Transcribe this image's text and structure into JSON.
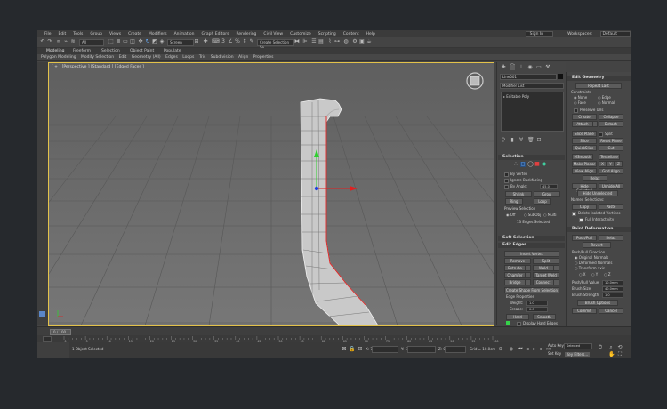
{
  "menu": [
    "File",
    "Edit",
    "Tools",
    "Group",
    "Views",
    "Create",
    "Modifiers",
    "Animation",
    "Graph Editors",
    "Rendering",
    "Civil View",
    "Customize",
    "Scripting",
    "Content",
    "Help"
  ],
  "sign_in": "Sign In",
  "workspaces_label": "Workspaces:",
  "workspaces_value": "Default",
  "toolbar": {
    "all_filter": "All",
    "ref_coord": "Screen",
    "selection_set": "Create Selection Se"
  },
  "ribbon_tabs": [
    "Modeling",
    "Freeform",
    "Selection",
    "Object Paint",
    "Populate"
  ],
  "ribbon_sub": [
    "Polygon Modeling",
    "Modify Selection",
    "Edit",
    "Geometry (All)",
    "Edges",
    "Loops",
    "Tris",
    "Subdivision",
    "Align",
    "Properties"
  ],
  "viewport_label": "[ + ] [Perspective ] [Standard ] [Edged Faces ]",
  "command_panel": {
    "object_name": "Line001",
    "modifier_list": "Modifier List",
    "stack_item": "Editable Poly",
    "selection": {
      "title": "Selection",
      "by_vertex": "By Vertex",
      "ignore_backfacing": "Ignore Backfacing",
      "by_angle": "By Angle:",
      "by_angle_value": "45.0",
      "shrink": "Shrink",
      "grow": "Grow",
      "ring": "Ring",
      "loop": "Loop",
      "preview_selection": "Preview Selection",
      "off": "Off",
      "subobj": "SubObj",
      "multi": "Multi",
      "selected_count": "13 Edges Selected"
    },
    "soft_selection": "Soft Selection",
    "edit_edges": {
      "title": "Edit Edges",
      "insert_vertex": "Insert Vertex",
      "remove": "Remove",
      "split": "Split",
      "extrude": "Extrude",
      "weld": "Weld",
      "chamfer": "Chamfer",
      "target_weld": "Target Weld",
      "bridge": "Bridge",
      "connect": "Connect",
      "create_shape": "Create Shape From Selection",
      "edge_properties": "Edge Properties",
      "weight": "Weight:",
      "weight_value": "1.0",
      "crease": "Crease:",
      "crease_value": "0.0",
      "hard": "Hard",
      "smooth": "Smooth",
      "display_hard": "Display Hard Edges"
    }
  },
  "edit_geometry": {
    "title": "Edit Geometry",
    "repeat_last": "Repeat Last",
    "constraints": "Constraints",
    "none": "None",
    "edge": "Edge",
    "face": "Face",
    "normal": "Normal",
    "preserve_uvs": "Preserve UVs",
    "create": "Create",
    "collapse": "Collapse",
    "attach": "Attach",
    "detach": "Detach",
    "slice_plane": "Slice Plane",
    "split": "Split",
    "slice": "Slice",
    "reset_plane": "Reset Plane",
    "quickslice": "QuickSlice",
    "cut": "Cut",
    "msmooth": "MSmooth",
    "tessellate": "Tessellate",
    "make_planar": "Make Planar",
    "x": "X",
    "y": "Y",
    "z": "Z",
    "view_align": "View Align",
    "grid_align": "Grid Align",
    "relax": "Relax",
    "hide_selected": "Hide Selected",
    "unhide_all": "Unhide All",
    "hide_unselected": "Hide Unselected",
    "named_selections": "Named Selections:",
    "copy": "Copy",
    "paste": "Paste",
    "delete_isolated": "Delete Isolated Vertices",
    "full_interactivity": "Full Interactivity"
  },
  "paint_deformation": {
    "title": "Paint Deformation",
    "push_pull": "Push/Pull",
    "relax": "Relax",
    "revert": "Revert",
    "direction": "Push/Pull Direction",
    "original_normals": "Original Normals",
    "deformed_normals": "Deformed Normals",
    "transform_axis": "Transform axis",
    "x": "X",
    "y": "Y",
    "z": "Z",
    "push_pull_value": "Push/Pull Value",
    "push_pull_value_num": "10.0mm",
    "brush_size": "Brush Size",
    "brush_size_num": "40.0mm",
    "brush_strength": "Brush Strength",
    "brush_strength_num": "1.0",
    "brush_options": "Brush Options",
    "commit": "Commit",
    "cancel": "Cancel"
  },
  "timeline": {
    "frame": "0 / 100",
    "ticks": [
      "0",
      "5",
      "10",
      "15",
      "20",
      "25",
      "30",
      "35",
      "40",
      "45",
      "50",
      "55",
      "60",
      "65",
      "70",
      "75",
      "80",
      "85",
      "90",
      "95",
      "100"
    ]
  },
  "status": {
    "selected": "1 Object Selected",
    "x": "X: 78.4mm",
    "y": "Y: -39.84mm",
    "z": "Z: 0.0mm",
    "grid": "Grid = 10.0cm",
    "auto_key": "Auto Key",
    "selected_mode": "Selected",
    "set_key": "Set Key",
    "key_filters": "Key Filters..."
  },
  "colors": {
    "accent": "#e3c24a",
    "viewport": "#6b6b6b",
    "axis_x": "#e03030",
    "axis_y": "#30c030",
    "axis_z": "#3050e0"
  }
}
